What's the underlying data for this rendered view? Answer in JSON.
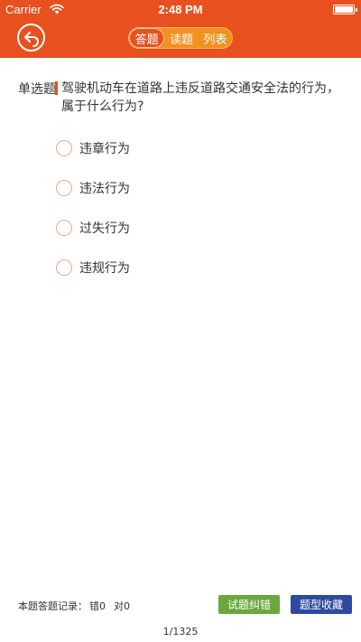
{
  "status_bar": {
    "carrier": "Carrier",
    "time": "2:48 PM"
  },
  "header": {
    "background_color": "#e8511f",
    "back_icon": "back-arrow-icon",
    "tabs": [
      {
        "label": "答题",
        "active": true
      },
      {
        "label": "读题",
        "active": false
      },
      {
        "label": "列表",
        "active": false
      }
    ]
  },
  "question": {
    "type_label": "单选题",
    "text": "驾驶机动车在道路上违反道路交通安全法的行为，属于什么行为?",
    "options": [
      {
        "label": "违章行为"
      },
      {
        "label": "违法行为"
      },
      {
        "label": "过失行为"
      },
      {
        "label": "违规行为"
      }
    ]
  },
  "footer": {
    "record_label": "本题答题记录：",
    "wrong_label": "错0",
    "right_label": "对0",
    "correct_button": "试题纠错",
    "correct_button_color": "#6aa83c",
    "favorite_button": "题型收藏",
    "favorite_button_color": "#2e4aa0",
    "page_indicator": "1/1325"
  }
}
